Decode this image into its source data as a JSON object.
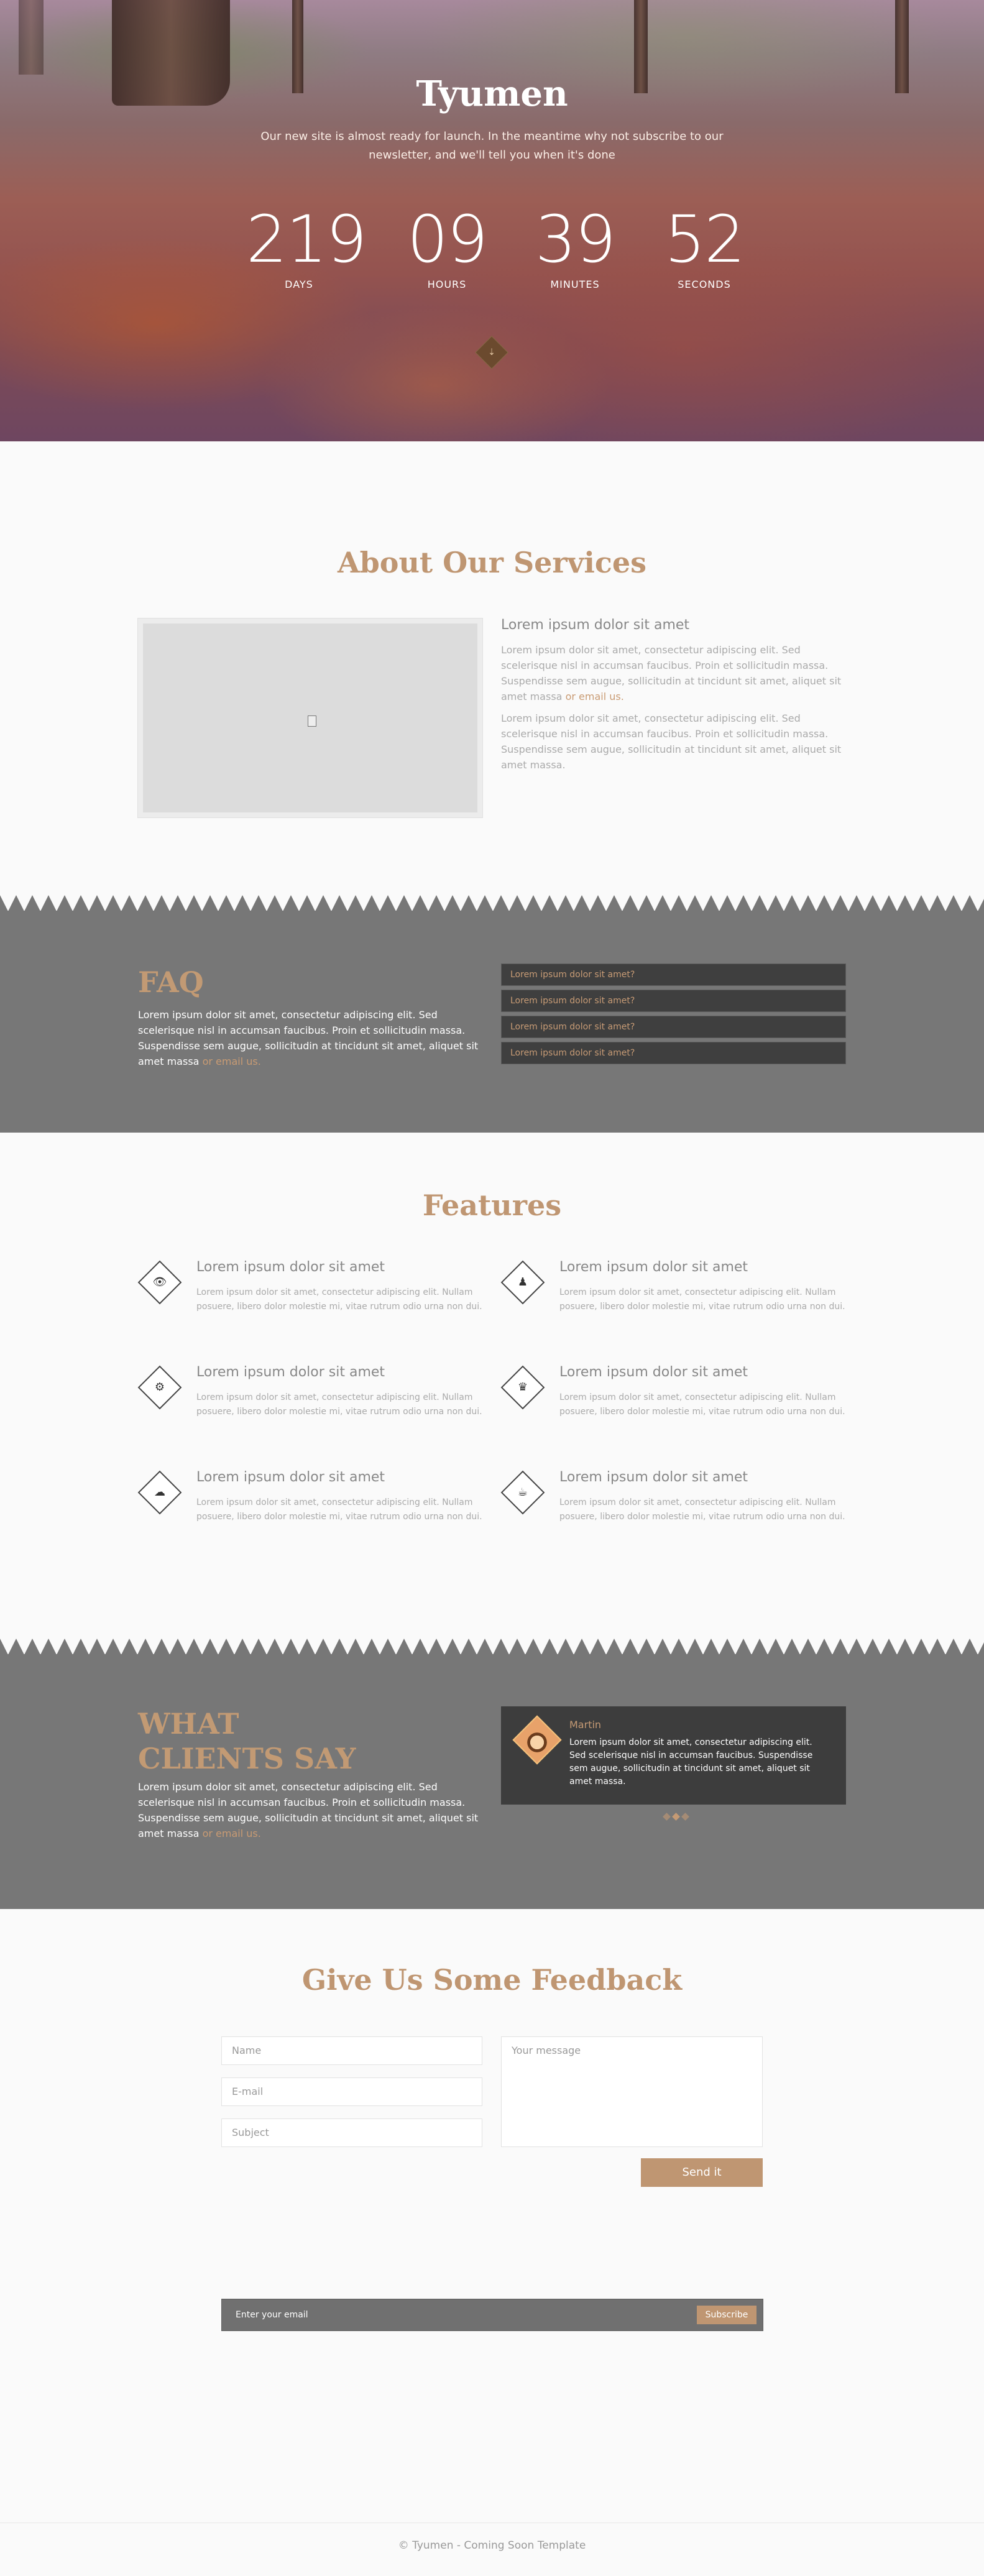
{
  "hero": {
    "title": "Tyumen",
    "subtitle": "Our new site is almost ready for launch. In the meantime why not subscribe to our newsletter, and we'll tell you when it's done",
    "countdown": [
      {
        "value": "219",
        "label": "DAYS"
      },
      {
        "value": "09",
        "label": "HOURS"
      },
      {
        "value": "39",
        "label": "MINUTES"
      },
      {
        "value": "52",
        "label": "SECONDS"
      }
    ],
    "scroll_icon": "chevron-down-double-icon"
  },
  "about": {
    "title": "About Our Services",
    "image_icon": "image-file-icon",
    "heading": "Lorem ipsum dolor sit amet",
    "p1": "Lorem ipsum dolor sit amet, consectetur adipiscing elit. Sed scelerisque nisl in accumsan faucibus. Proin et sollicitudin massa. Suspendisse sem augue, sollicitudin at tincidunt sit amet, aliquet sit amet massa",
    "p1_link": "or email us.",
    "p2": "Lorem ipsum dolor sit amet, consectetur adipiscing elit. Sed scelerisque nisl in accumsan faucibus. Proin et sollicitudin massa. Suspendisse sem augue, sollicitudin at tincidunt sit amet, aliquet sit amet massa."
  },
  "faq": {
    "title": "FAQ",
    "text": "Lorem ipsum dolor sit amet, consectetur adipiscing elit. Sed scelerisque nisl in accumsan faucibus. Proin et sollicitudin massa. Suspendisse sem augue, sollicitudin at tincidunt sit amet, aliquet sit amet massa",
    "link": "or email us.",
    "items": [
      "Lorem ipsum dolor sit amet?",
      "Lorem ipsum dolor sit amet?",
      "Lorem ipsum dolor sit amet?",
      "Lorem ipsum dolor sit amet?"
    ]
  },
  "features": {
    "title": "Features",
    "items": [
      {
        "icon": "eye-icon",
        "heading": "Lorem ipsum dolor sit amet",
        "text": "Lorem ipsum dolor sit amet, consectetur adipiscing elit. Nullam posuere, libero dolor molestie mi, vitae rutrum odio urna non dui."
      },
      {
        "icon": "users-icon",
        "heading": "Lorem ipsum dolor sit amet",
        "text": "Lorem ipsum dolor sit amet, consectetur adipiscing elit. Nullam posuere, libero dolor molestie mi, vitae rutrum odio urna non dui."
      },
      {
        "icon": "gear-icon",
        "heading": "Lorem ipsum dolor sit amet",
        "text": "Lorem ipsum dolor sit amet, consectetur adipiscing elit. Nullam posuere, libero dolor molestie mi, vitae rutrum odio urna non dui."
      },
      {
        "icon": "trophy-icon",
        "heading": "Lorem ipsum dolor sit amet",
        "text": "Lorem ipsum dolor sit amet, consectetur adipiscing elit. Nullam posuere, libero dolor molestie mi, vitae rutrum odio urna non dui."
      },
      {
        "icon": "cloud-download-icon",
        "heading": "Lorem ipsum dolor sit amet",
        "text": "Lorem ipsum dolor sit amet, consectetur adipiscing elit. Nullam posuere, libero dolor molestie mi, vitae rutrum odio urna non dui."
      },
      {
        "icon": "coffee-icon",
        "heading": "Lorem ipsum dolor sit amet",
        "text": "Lorem ipsum dolor sit amet, consectetur adipiscing elit. Nullam posuere, libero dolor molestie mi, vitae rutrum odio urna non dui."
      }
    ]
  },
  "clients": {
    "title_line1": "WHAT",
    "title_line2": "CLIENTS SAY",
    "text": "Lorem ipsum dolor sit amet, consectetur adipiscing elit. Sed scelerisque nisl in accumsan faucibus. Proin et sollicitudin massa. Suspendisse sem augue, sollicitudin at tincidunt sit amet, aliquet sit amet massa",
    "link": "or email us.",
    "testimonial": {
      "name": "Martin",
      "text": "Lorem ipsum dolor sit amet, consectetur adipiscing elit. Sed scelerisque nisl in accumsan faucibus. Suspendisse sem augue, sollicitudin at tincidunt sit amet, aliquet sit amet massa."
    }
  },
  "feedback": {
    "title": "Give Us Some Feedback",
    "name_placeholder": "Name",
    "email_placeholder": "E-mail",
    "subject_placeholder": "Subject",
    "message_placeholder": "Your message",
    "send_label": "Send it"
  },
  "newsletter": {
    "placeholder": "Enter your email",
    "button": "Subscribe"
  },
  "footer": {
    "text": "© Tyumen - Coming Soon Template"
  },
  "colors": {
    "accent": "#bf9672",
    "band": "#777777",
    "dark_box": "#3d3d3d"
  }
}
